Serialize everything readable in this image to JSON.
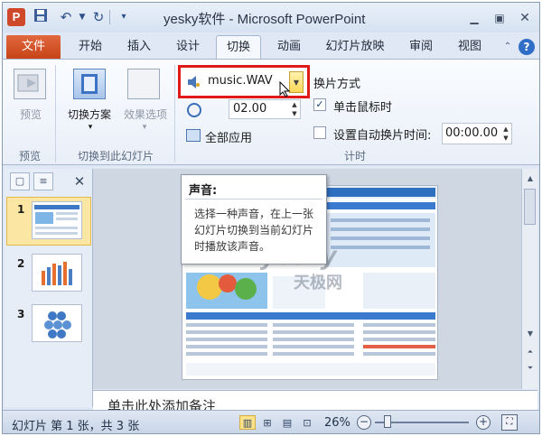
{
  "titlebar": {
    "app_icon": "P",
    "title": "yesky软件 - Microsoft PowerPoint",
    "quick_access": [
      "save-icon",
      "undo-icon",
      "redo-icon",
      "customize-icon"
    ],
    "window_controls": [
      "minimize-icon",
      "restore-icon",
      "close-icon"
    ]
  },
  "tabs": {
    "file": "文件",
    "items": [
      "开始",
      "插入",
      "设计",
      "切换",
      "动画",
      "幻灯片放映",
      "审阅",
      "视图"
    ],
    "active": "切换"
  },
  "ribbon": {
    "preview": {
      "button": "预览",
      "group": "预览"
    },
    "transition": {
      "scheme": "切换方案",
      "effects": "效果选项",
      "group": "切换到此幻灯片"
    },
    "timing": {
      "sound_value": "music.WAV",
      "duration_value": "02.00",
      "apply_all": "全部应用",
      "switch_mode_title": "换片方式",
      "on_click_label": "单击鼠标时",
      "on_click_checked": true,
      "auto_after_label": "设置自动换片时间:",
      "auto_after_checked": false,
      "auto_time": "00:00.00",
      "group": "计时"
    }
  },
  "tooltip": {
    "title": "声音:",
    "body": "选择一种声音，在上一张幻灯片切换到当前幻灯片时播放该声音。"
  },
  "slides": {
    "items": [
      {
        "number": "1",
        "selected": true
      },
      {
        "number": "2",
        "selected": false
      },
      {
        "number": "3",
        "selected": false
      }
    ]
  },
  "notes": {
    "placeholder": "单击此处添加备注"
  },
  "watermark": {
    "text": "yesky",
    "subtext": "天极网"
  },
  "status": {
    "slide_info": "幻灯片 第 1 张，共 3 张",
    "zoom": "26%",
    "zoom_level": 0.26
  }
}
